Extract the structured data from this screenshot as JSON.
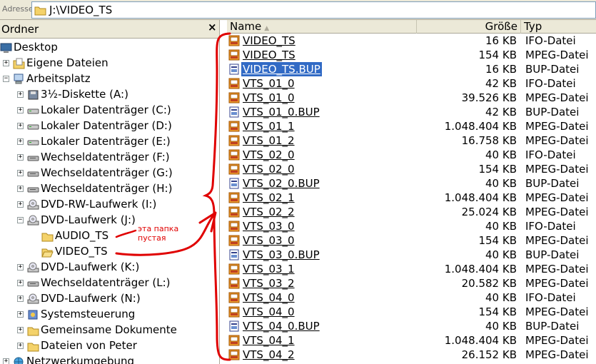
{
  "address": {
    "label": "Adresse",
    "path": "J:\\VIDEO_TS"
  },
  "folder_pane": {
    "title": "Ordner",
    "close": "×",
    "tree": [
      {
        "label": "Desktop",
        "level": 0,
        "icon": "desktop-icon",
        "expander": ""
      },
      {
        "label": "Eigene Dateien",
        "level": 1,
        "icon": "my-documents-icon",
        "expander": "+"
      },
      {
        "label": "Arbeitsplatz",
        "level": 1,
        "icon": "my-computer-icon",
        "expander": "−"
      },
      {
        "label": "3½-Diskette (A:)",
        "level": 2,
        "icon": "floppy-drive-icon",
        "expander": "+"
      },
      {
        "label": "Lokaler Datenträger (C:)",
        "level": 2,
        "icon": "hard-drive-icon",
        "expander": "+"
      },
      {
        "label": "Lokaler Datenträger (D:)",
        "level": 2,
        "icon": "hard-drive-icon",
        "expander": "+"
      },
      {
        "label": "Lokaler Datenträger (E:)",
        "level": 2,
        "icon": "hard-drive-icon",
        "expander": "+"
      },
      {
        "label": "Wechseldatenträger (F:)",
        "level": 2,
        "icon": "removable-drive-icon",
        "expander": "+"
      },
      {
        "label": "Wechseldatenträger (G:)",
        "level": 2,
        "icon": "removable-drive-icon",
        "expander": "+"
      },
      {
        "label": "Wechseldatenträger (H:)",
        "level": 2,
        "icon": "removable-drive-icon",
        "expander": "+"
      },
      {
        "label": "DVD-RW-Laufwerk (I:)",
        "level": 2,
        "icon": "dvd-drive-icon",
        "expander": "+"
      },
      {
        "label": "DVD-Laufwerk (J:)",
        "level": 2,
        "icon": "dvd-drive-icon",
        "expander": "−"
      },
      {
        "label": "AUDIO_TS",
        "level": 3,
        "icon": "folder-icon",
        "expander": ""
      },
      {
        "label": "VIDEO_TS",
        "level": 3,
        "icon": "folder-open-icon",
        "expander": ""
      },
      {
        "label": "DVD-Laufwerk (K:)",
        "level": 2,
        "icon": "dvd-drive-icon",
        "expander": "+"
      },
      {
        "label": "Wechseldatenträger (L:)",
        "level": 2,
        "icon": "removable-drive-icon",
        "expander": "+"
      },
      {
        "label": "DVD-Laufwerk (N:)",
        "level": 2,
        "icon": "dvd-drive-icon",
        "expander": "+"
      },
      {
        "label": "Systemsteuerung",
        "level": 2,
        "icon": "control-panel-icon",
        "expander": "+"
      },
      {
        "label": "Gemeinsame Dokumente",
        "level": 2,
        "icon": "folder-icon",
        "expander": "+"
      },
      {
        "label": "Dateien von Peter",
        "level": 2,
        "icon": "folder-icon",
        "expander": "+"
      },
      {
        "label": "Netzwerkumgebung",
        "level": 1,
        "icon": "network-icon",
        "expander": "+"
      }
    ]
  },
  "columns": {
    "name": "Name",
    "size": "Größe",
    "type": "Typ"
  },
  "files": [
    {
      "name": "VIDEO_TS",
      "size": "16 KB",
      "type": "IFO-Datei",
      "icon": "ifo-file-icon"
    },
    {
      "name": "VIDEO_TS",
      "size": "154 KB",
      "type": "MPEG-Datei",
      "icon": "mpeg-file-icon"
    },
    {
      "name": "VIDEO_TS.BUP",
      "size": "16 KB",
      "type": "BUP-Datei",
      "icon": "bup-file-icon",
      "selected": true
    },
    {
      "name": "VTS_01_0",
      "size": "42 KB",
      "type": "IFO-Datei",
      "icon": "ifo-file-icon"
    },
    {
      "name": "VTS_01_0",
      "size": "39.526 KB",
      "type": "MPEG-Datei",
      "icon": "mpeg-file-icon"
    },
    {
      "name": "VTS_01_0.BUP",
      "size": "42 KB",
      "type": "BUP-Datei",
      "icon": "bup-file-icon"
    },
    {
      "name": "VTS_01_1",
      "size": "1.048.404 KB",
      "type": "MPEG-Datei",
      "icon": "mpeg-file-icon"
    },
    {
      "name": "VTS_01_2",
      "size": "16.758 KB",
      "type": "MPEG-Datei",
      "icon": "mpeg-file-icon"
    },
    {
      "name": "VTS_02_0",
      "size": "40 KB",
      "type": "IFO-Datei",
      "icon": "ifo-file-icon"
    },
    {
      "name": "VTS_02_0",
      "size": "154 KB",
      "type": "MPEG-Datei",
      "icon": "mpeg-file-icon"
    },
    {
      "name": "VTS_02_0.BUP",
      "size": "40 KB",
      "type": "BUP-Datei",
      "icon": "bup-file-icon"
    },
    {
      "name": "VTS_02_1",
      "size": "1.048.404 KB",
      "type": "MPEG-Datei",
      "icon": "mpeg-file-icon"
    },
    {
      "name": "VTS_02_2",
      "size": "25.024 KB",
      "type": "MPEG-Datei",
      "icon": "mpeg-file-icon"
    },
    {
      "name": "VTS_03_0",
      "size": "40 KB",
      "type": "IFO-Datei",
      "icon": "ifo-file-icon"
    },
    {
      "name": "VTS_03_0",
      "size": "154 KB",
      "type": "MPEG-Datei",
      "icon": "mpeg-file-icon"
    },
    {
      "name": "VTS_03_0.BUP",
      "size": "40 KB",
      "type": "BUP-Datei",
      "icon": "bup-file-icon"
    },
    {
      "name": "VTS_03_1",
      "size": "1.048.404 KB",
      "type": "MPEG-Datei",
      "icon": "mpeg-file-icon"
    },
    {
      "name": "VTS_03_2",
      "size": "20.582 KB",
      "type": "MPEG-Datei",
      "icon": "mpeg-file-icon"
    },
    {
      "name": "VTS_04_0",
      "size": "40 KB",
      "type": "IFO-Datei",
      "icon": "ifo-file-icon"
    },
    {
      "name": "VTS_04_0",
      "size": "154 KB",
      "type": "MPEG-Datei",
      "icon": "mpeg-file-icon"
    },
    {
      "name": "VTS_04_0.BUP",
      "size": "40 KB",
      "type": "BUP-Datei",
      "icon": "bup-file-icon"
    },
    {
      "name": "VTS_04_1",
      "size": "1.048.404 KB",
      "type": "MPEG-Datei",
      "icon": "mpeg-file-icon"
    },
    {
      "name": "VTS_04_2",
      "size": "26.152 KB",
      "type": "MPEG-Datei",
      "icon": "mpeg-file-icon"
    }
  ],
  "annotation": {
    "text": "эта папка\nпустая",
    "color": "#e00000"
  },
  "colors": {
    "selection": "#316ac5",
    "chrome": "#ece9d8",
    "annotation": "#e00000"
  }
}
